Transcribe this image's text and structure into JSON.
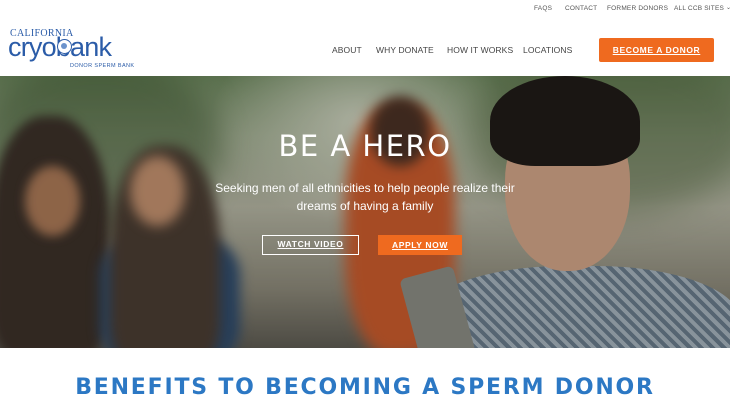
{
  "utility_nav": {
    "faqs": "FAQS",
    "contact": "CONTACT",
    "former_donors": "FORMER DONORS",
    "all_sites": "ALL CCB SITES"
  },
  "logo": {
    "top": "CALIFORNIA",
    "main": "cryobank",
    "sub": "DONOR SPERM BANK"
  },
  "main_nav": {
    "about": "ABOUT",
    "why_donate": "WHY DONATE",
    "how_it_works": "HOW IT WORKS",
    "locations": "LOCATIONS",
    "cta": "BECOME A DONOR"
  },
  "hero": {
    "title": "BE A HERO",
    "subtitle": "Seeking men of all ethnicities to help people realize their dreams of having a family",
    "watch_label": "WATCH VIDEO",
    "apply_label": "APPLY NOW"
  },
  "section": {
    "heading": "BENEFITS TO BECOMING A SPERM DONOR"
  },
  "colors": {
    "accent": "#ef6a1f",
    "brand": "#2b5ca8",
    "heading": "#2c78c4"
  },
  "icons": {
    "dropdown": "chevron-down-icon"
  }
}
